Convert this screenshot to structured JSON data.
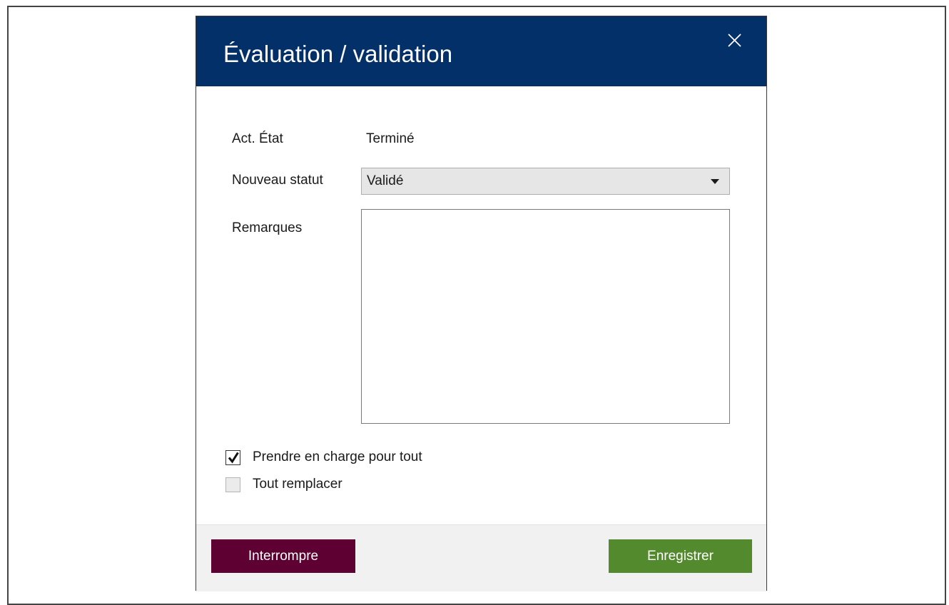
{
  "dialog": {
    "title": "Évaluation / validation",
    "close_icon": "close-icon",
    "colors": {
      "titlebar": "#04306a",
      "cancel_button": "#5e0031",
      "save_button": "#548a2e"
    }
  },
  "form": {
    "current_state_label": "Act. État",
    "current_state_value": "Terminé",
    "new_status_label": "Nouveau statut",
    "new_status_value": "Validé",
    "remarks_label": "Remarques",
    "remarks_value": "",
    "dropdown_icon": "chevron-down-icon"
  },
  "options": {
    "take_charge_all": {
      "label": "Prendre en charge pour tout",
      "checked": true
    },
    "replace_all": {
      "label": "Tout remplacer",
      "checked": false
    }
  },
  "footer": {
    "cancel_label": "Interrompre",
    "save_label": "Enregistrer"
  }
}
